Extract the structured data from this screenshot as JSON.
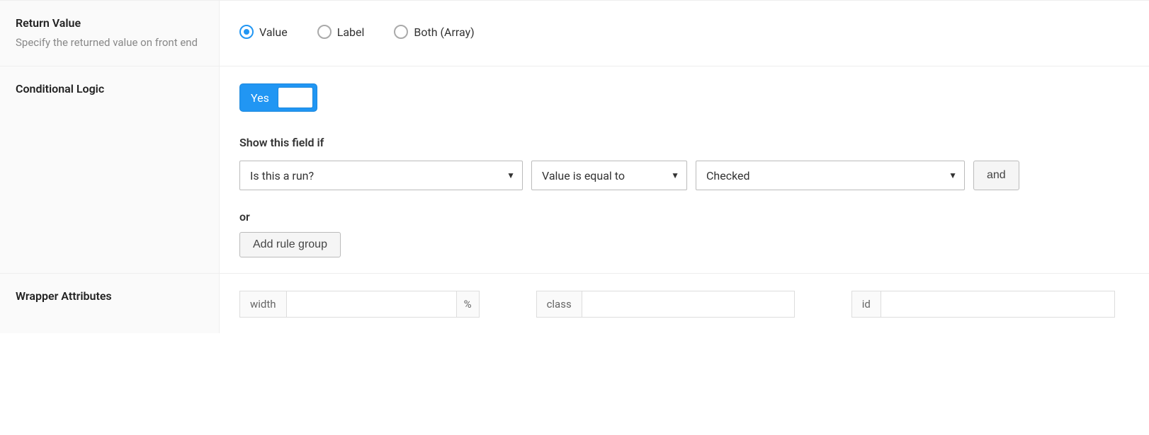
{
  "returnValue": {
    "title": "Return Value",
    "desc": "Specify the returned value on front end",
    "options": {
      "value": "Value",
      "label": "Label",
      "both": "Both (Array)"
    }
  },
  "conditionalLogic": {
    "title": "Conditional Logic",
    "toggleLabel": "Yes",
    "showHeading": "Show this field if",
    "rule": {
      "field": "Is this a run?",
      "operator": "Value is equal to",
      "value": "Checked"
    },
    "andLabel": "and",
    "orLabel": "or",
    "addGroupLabel": "Add rule group"
  },
  "wrapper": {
    "title": "Wrapper Attributes",
    "widthLabel": "width",
    "widthSuffix": "%",
    "widthValue": "",
    "classLabel": "class",
    "classValue": "",
    "idLabel": "id",
    "idValue": ""
  }
}
